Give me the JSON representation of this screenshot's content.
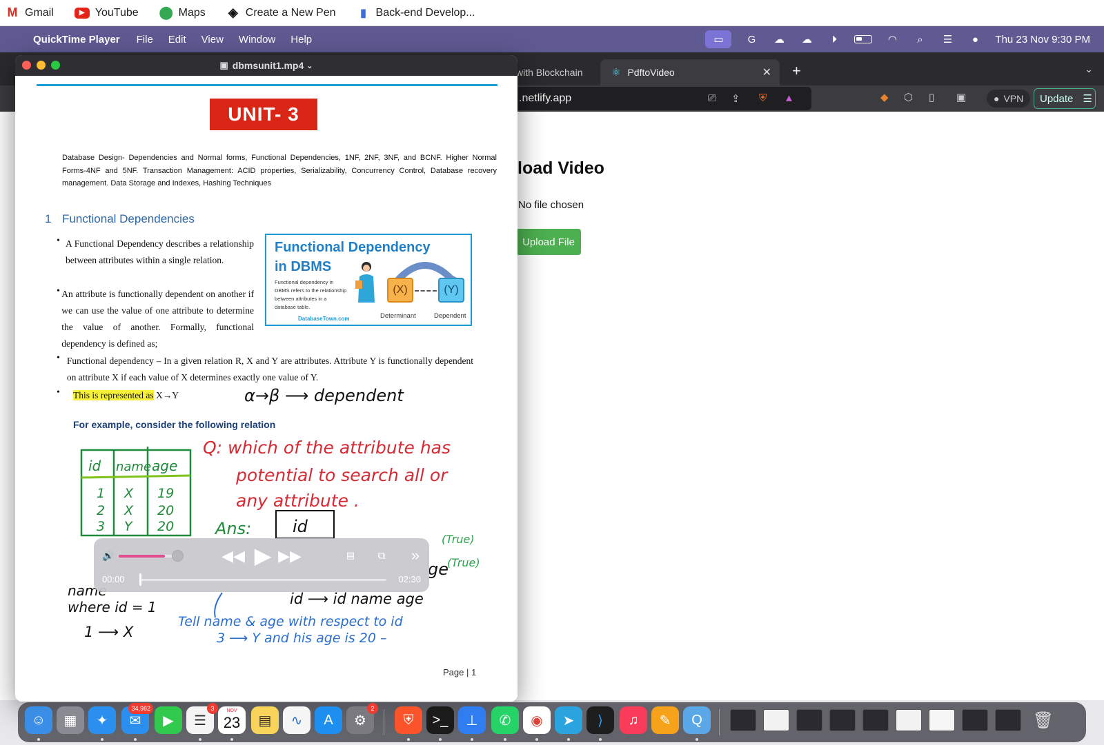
{
  "bookmarks": [
    {
      "label": "Gmail",
      "icon": "gmail-icon"
    },
    {
      "label": "YouTube",
      "icon": "youtube-icon"
    },
    {
      "label": "Maps",
      "icon": "maps-icon"
    },
    {
      "label": "Create a New Pen",
      "icon": "codepen-icon"
    },
    {
      "label": "Back-end Develop...",
      "icon": "doc-icon"
    }
  ],
  "menubar": {
    "app_name": "QuickTime Player",
    "items": [
      "File",
      "Edit",
      "View",
      "Window",
      "Help"
    ],
    "datetime": "Thu 23 Nov  9:30 PM"
  },
  "browser": {
    "tab_partial": "with Blockchain",
    "tab_active": "PdftoVideo",
    "url": ".netlify.app",
    "vpn": "VPN",
    "update": "Update",
    "page": {
      "heading": "load Video",
      "file_status": "No file chosen",
      "upload_button": "Upload File"
    }
  },
  "quicktime": {
    "filename": "dbmsunit1.mp4",
    "video": {
      "unit_banner": "UNIT- 3",
      "syllabus": "Database Design- Dependencies and Normal forms, Functional Dependencies, 1NF, 2NF, 3NF, and BCNF. Higher Normal Forms-4NF and 5NF. Transaction Management: ACID properties, Serializability, Concurrency Control, Database recovery management. Data Storage and Indexes, Hashing Techniques",
      "section_number": "1",
      "section_title": "Functional Dependencies",
      "bullet1": "A Functional Dependency describes a relationship between attributes within a single relation.",
      "bullet2": "An attribute is functionally dependent on another if we can use the value of one attribute to determine the value of another. Formally, functional dependency is defined as;",
      "bullet3": "Functional dependency – In a given relation R, X and Y are attributes. Attribute Y is functionally dependent on attribute X if each value of X determines exactly one value of Y.",
      "bullet4_highlight": "This is represented as",
      "bullet4_rest": " X→Y",
      "card": {
        "title_line1": "Functional Dependency",
        "title_line2": "in DBMS",
        "description": "Functional dependency in DBMS refers to the relationship between attributes in a database table.",
        "site": "DatabaseTown.com",
        "x_box": "(X)",
        "y_box": "(Y)",
        "determinant": "Determinant",
        "dependent": "Dependent"
      },
      "example": "For example, consider the following relation",
      "page": "Page | 1",
      "handwriting": {
        "arrow_note": "α→β ⟶ dependent",
        "question_line1": "Q: which of the attribute has",
        "question_line2": "potential to search all or",
        "question_line3": "any attribute .",
        "answer_label": "Ans:",
        "answer_value": "id",
        "true1": "(True)",
        "true2": "(True)",
        "ge_fragment": "ge",
        "name_where1": "name",
        "name_where2": "where  id = 1",
        "id_arrow": "id ⟶ id name  age",
        "tell_line": "Tell name & age with respect to id",
        "three_line": "3 ⟶   Y  and  his age is 20 –",
        "one_line": "1 ⟶ X",
        "table_headers": [
          "id",
          "name",
          "age"
        ],
        "table_rows": [
          [
            "1",
            "X",
            "19"
          ],
          [
            "2",
            "X",
            "20"
          ],
          [
            "3",
            "Y",
            "20"
          ]
        ]
      }
    },
    "player": {
      "current_time": "00:00",
      "total_time": "02:30",
      "progress": 0.0,
      "volume": 0.8
    }
  },
  "dock": {
    "mail_badge": "34,982",
    "reminders_badge": "3",
    "settings_badge": "2",
    "calendar_month": "NOV",
    "calendar_day": "23"
  }
}
